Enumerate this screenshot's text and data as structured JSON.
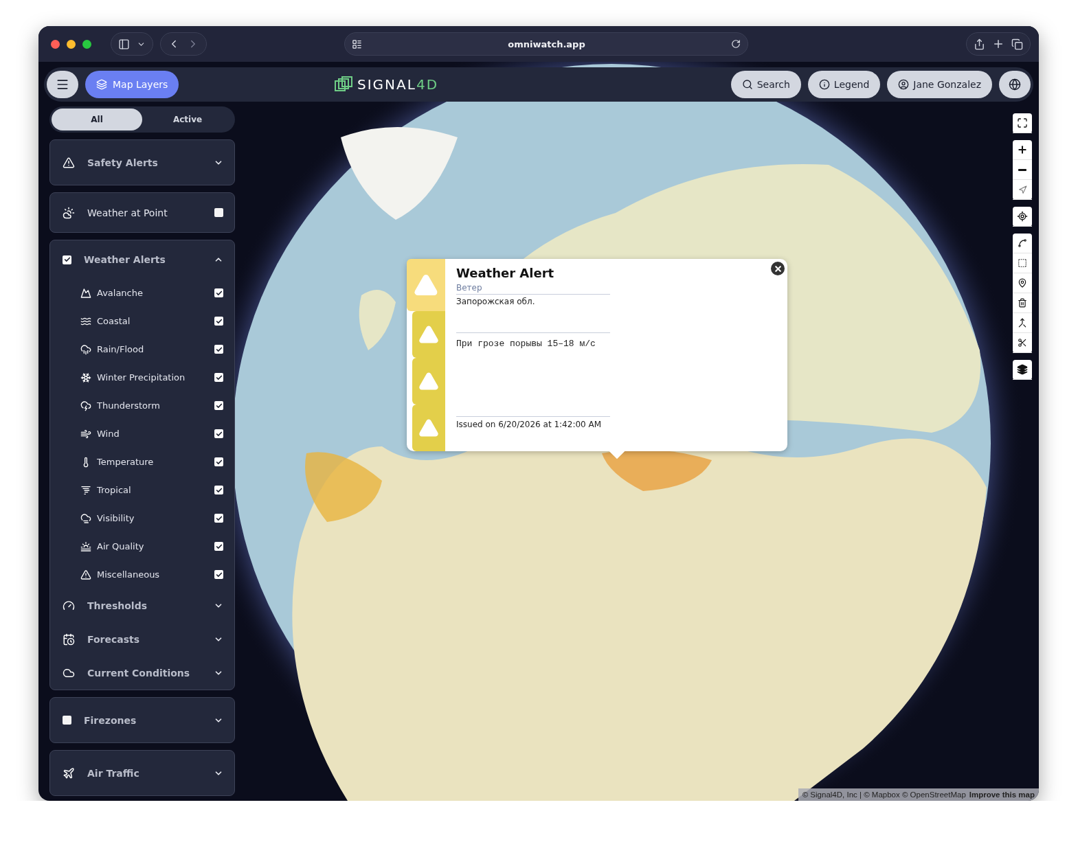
{
  "browser": {
    "url": "omniwatch.app"
  },
  "header": {
    "layers_button": {
      "label": "Map Layers",
      "selected": true
    },
    "logo": {
      "text": "SIGNAL",
      "accent": "4D"
    },
    "buttons": [
      {
        "kind": "search",
        "label": "Search"
      },
      {
        "kind": "info",
        "label": "Legend"
      },
      {
        "kind": "user",
        "label": "Jane Gonzalez"
      }
    ]
  },
  "sidebar": {
    "filter_tabs": [
      {
        "label": "All",
        "selected": true
      },
      {
        "label": "Active",
        "selected": false
      }
    ],
    "panels": [
      {
        "kind": "collapsible",
        "label": "Safety Alerts",
        "expanded": false
      },
      {
        "kind": "toggle",
        "label": "Weather at Point",
        "checked": false
      },
      {
        "kind": "checkable",
        "label": "Weather Alerts",
        "checked": true,
        "expanded": true,
        "items": [
          {
            "label": "Avalanche",
            "checked": true
          },
          {
            "label": "Coastal",
            "checked": true
          },
          {
            "label": "Rain/Flood",
            "checked": true
          },
          {
            "label": "Winter Precipitation",
            "checked": true
          },
          {
            "label": "Thunderstorm",
            "checked": true
          },
          {
            "label": "Wind",
            "checked": true
          },
          {
            "label": "Temperature",
            "checked": true
          },
          {
            "label": "Tropical",
            "checked": true
          },
          {
            "label": "Visibility",
            "checked": true
          },
          {
            "label": "Air Quality",
            "checked": true
          },
          {
            "label": "Miscellaneous",
            "checked": true
          }
        ],
        "subsections": [
          {
            "label": "Thresholds",
            "expanded": false
          },
          {
            "label": "Forecasts",
            "expanded": false
          },
          {
            "label": "Current Conditions",
            "expanded": false
          }
        ]
      },
      {
        "kind": "checkable",
        "label": "Firezones",
        "checked": false,
        "expanded": false
      },
      {
        "kind": "collapsible",
        "label": "Air Traffic",
        "expanded": false
      }
    ]
  },
  "popup": {
    "title": "Weather Alert",
    "subtitle": "Ветер",
    "area": "Запорожская обл.",
    "description": "При грозе порывы 15–18 м/с",
    "issued": "Issued on 6/20/2026 at 1:42:00 AM",
    "tabs": [
      {
        "selected": true
      },
      {
        "selected": false
      },
      {
        "selected": false
      },
      {
        "selected": false
      }
    ]
  },
  "attribution": {
    "text": "© Signal4D, Inc | © Mapbox © OpenStreetMap",
    "link": "Improve this map"
  }
}
